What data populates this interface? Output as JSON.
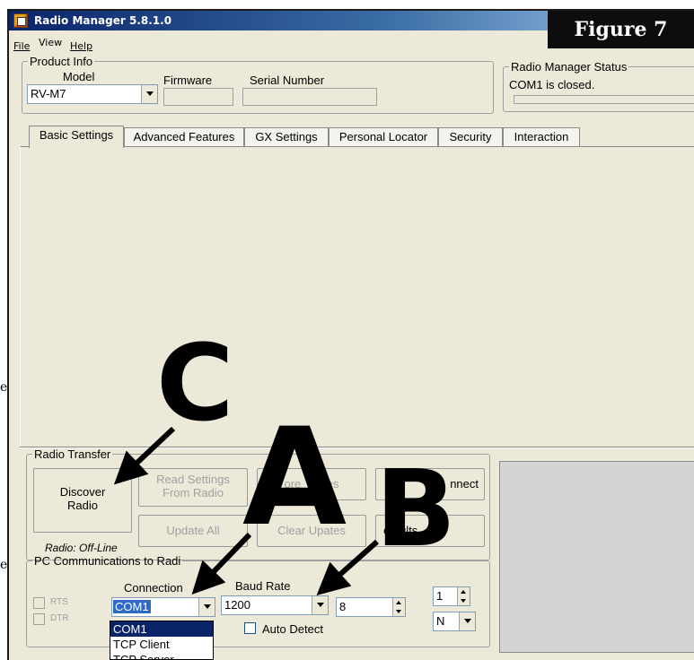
{
  "window": {
    "title": "Radio Manager 5.8.1.0"
  },
  "figure_label": "Figure 7",
  "menu": {
    "file": "File",
    "view": "View",
    "help": "Help"
  },
  "product_info": {
    "legend": "Product Info",
    "model_label": "Model",
    "model_value": "RV-M7",
    "firmware_label": "Firmware",
    "firmware_value": "",
    "serial_label": "Serial Number",
    "serial_value": ""
  },
  "status": {
    "legend": "Radio Manager Status",
    "text": "COM1 is closed.",
    "progress": 0
  },
  "tabs": [
    "Basic Settings",
    "Advanced Features",
    "GX Settings",
    "Personal Locator",
    "Security",
    "Interaction"
  ],
  "radio_transfer": {
    "legend": "Radio Transfer",
    "discover_line1": "Discover",
    "discover_line2": "Radio",
    "read_line1": "Read Settings",
    "read_line2": "From Radio",
    "store_updates": "ore",
    "store_updates_tail": "ates",
    "connect": "nnect",
    "update_all": "Update All",
    "clear_updates": "Clear Up",
    "clear_updates_tail": "ates",
    "defaults": "efaults",
    "radio_state": "Radio: Off-Line"
  },
  "pc_comm": {
    "legend": "PC Communications to Radi",
    "connection_label": "Connection",
    "connection_value": "COM1",
    "baud_label": "Baud Rate",
    "baud_value": "1200",
    "data_bits_value": "8",
    "stop_bits_value": "1",
    "parity_value": "N",
    "rts_label": "RTS",
    "dtr_label": "DTR",
    "auto_detect_label": "Auto Detect",
    "dropdown_options": [
      "COM1",
      "TCP Client",
      "TCP Server"
    ]
  },
  "annotations": {
    "a": "A",
    "b": "B",
    "c": "C"
  },
  "edge_letters": [
    "e",
    "e"
  ]
}
